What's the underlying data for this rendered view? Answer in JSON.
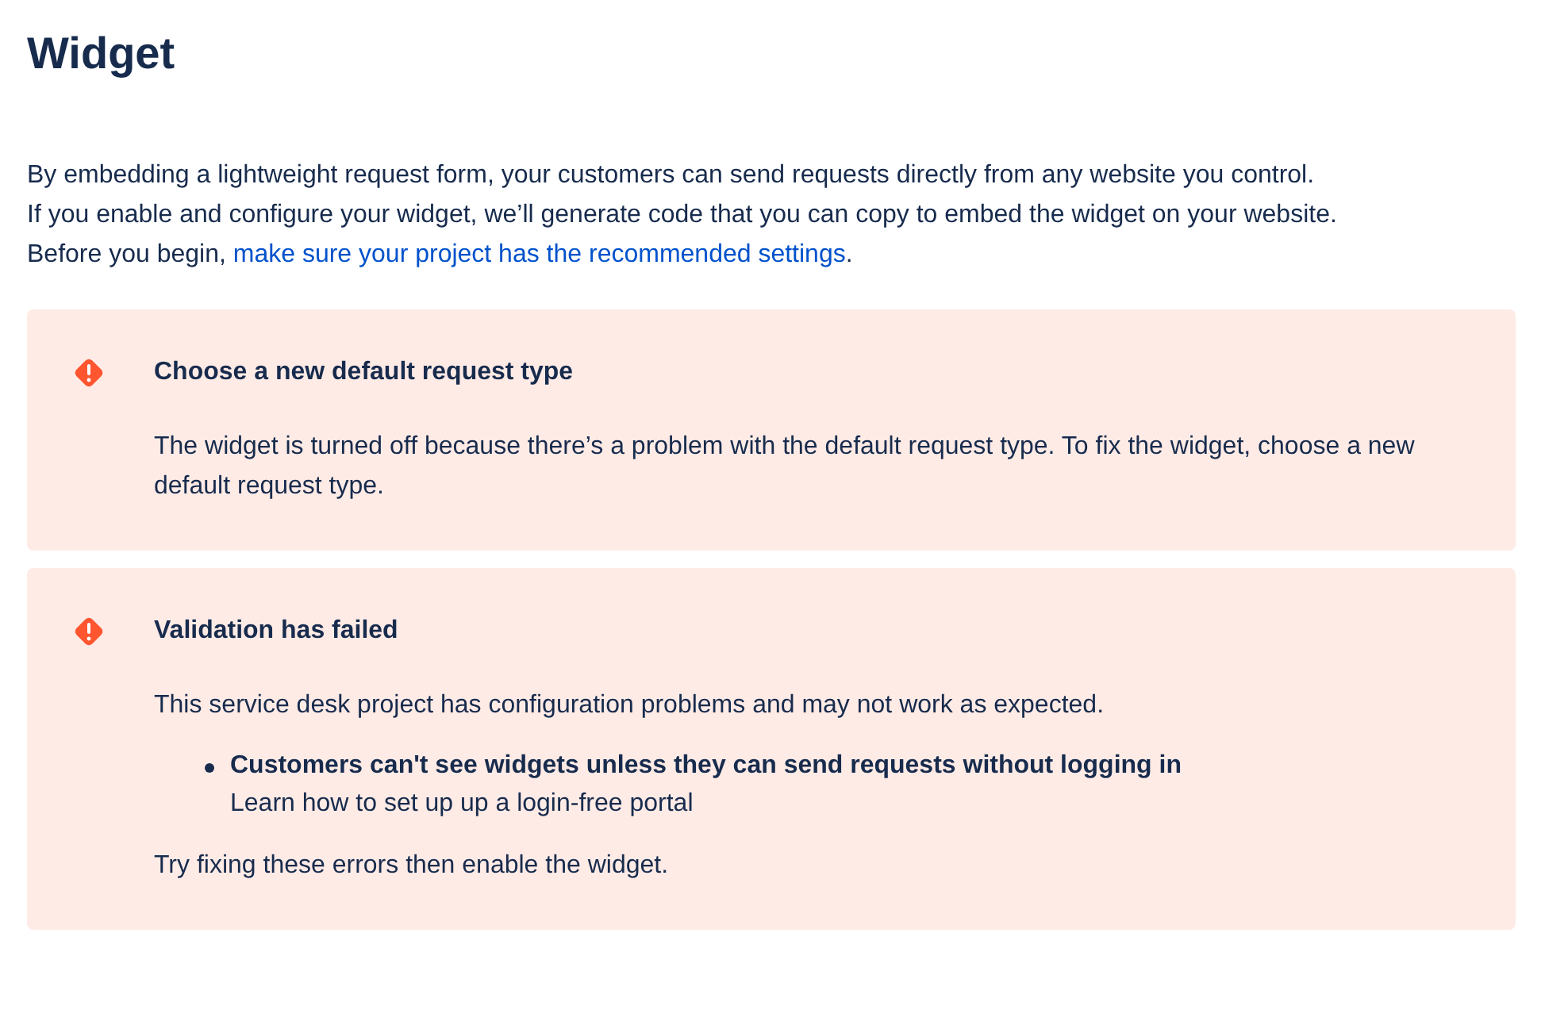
{
  "title": "Widget",
  "intro": {
    "lines": [
      "By embedding a lightweight request form, your customers can send requests directly from any website you control.",
      "If you enable and configure your widget, we’ll generate code that you can copy to embed the widget on your website."
    ],
    "before_link": "Before you begin, ",
    "link": "make sure your project has the recommended settings",
    "after_link": "."
  },
  "alerts": [
    {
      "kind": "error",
      "title": "Choose a new default request type",
      "body": [
        {
          "kind": "paragraph",
          "text": "The widget is turned off because there’s a problem with the default request type. To fix the widget, choose a new default request type."
        }
      ]
    },
    {
      "kind": "error",
      "title": "Validation has failed",
      "body": [
        {
          "kind": "paragraph",
          "text": "This service desk project has configuration problems and may not work as expected."
        },
        {
          "kind": "bullet",
          "title": "Customers can't see widgets unless they can send requests without logging in",
          "detail": "Learn how to set up up a login-free portal"
        },
        {
          "kind": "paragraph",
          "text": "Try fixing these errors then enable the widget."
        }
      ]
    }
  ]
}
